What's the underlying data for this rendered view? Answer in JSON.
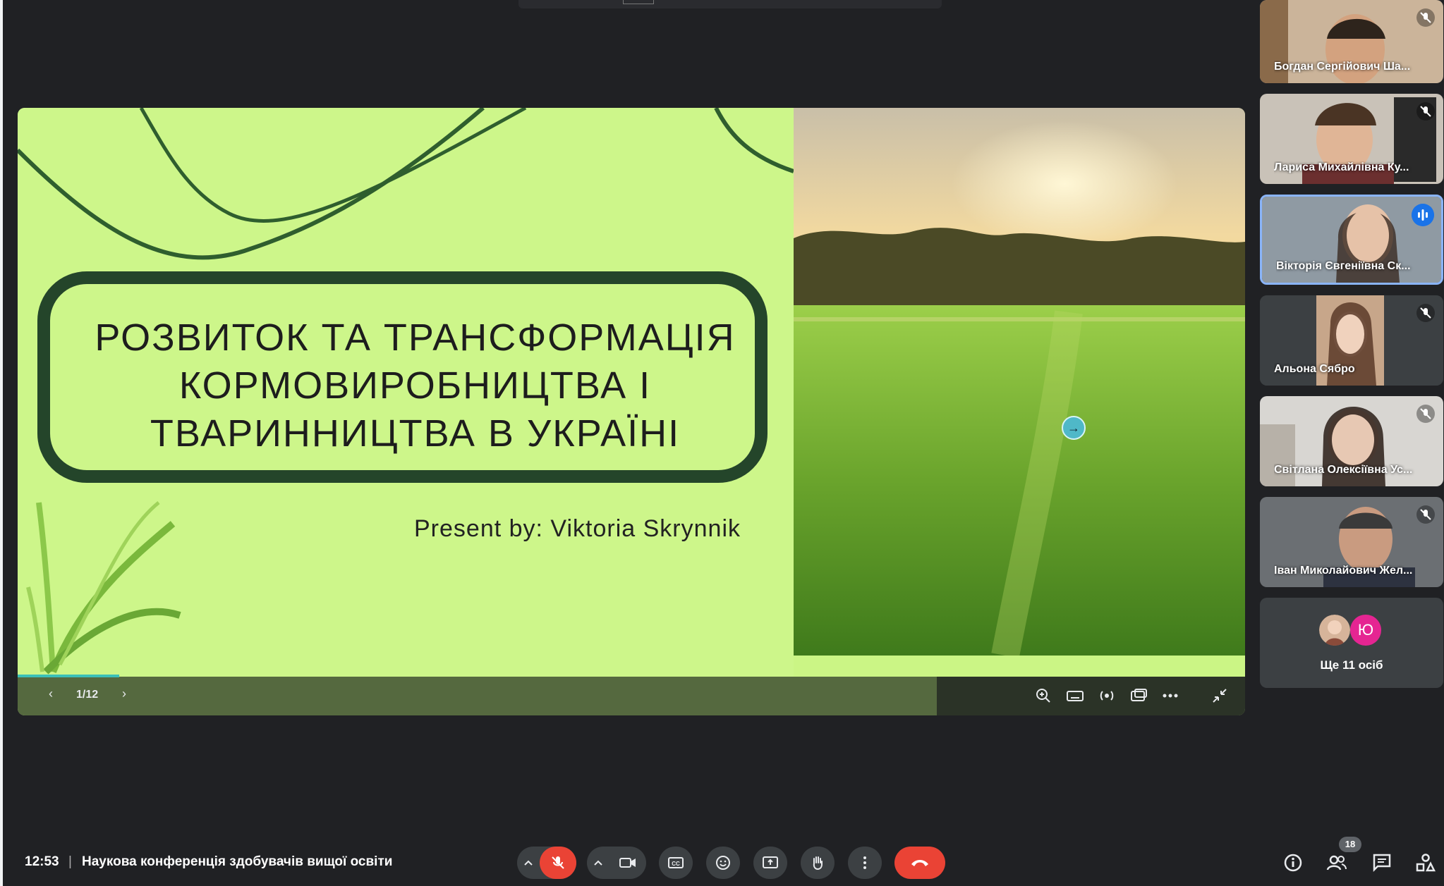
{
  "slide": {
    "title_lines": [
      "РОЗВИТОК ТА ТРАНСФОРМАЦІЯ",
      "КОРМОВИРОБНИЦТВА І",
      "ТВАРИННИЦТВА В УКРАЇНІ"
    ],
    "presenter": "Present by: Viktoria Skrynnik",
    "page_indicator": "1/12",
    "progress_fraction": 0.083
  },
  "participants": [
    {
      "name": "Богдан Сергійович Ша...",
      "muted": true,
      "speaking": false
    },
    {
      "name": "Лариса Михайлівна Ку...",
      "muted": true,
      "speaking": false
    },
    {
      "name": "Вікторія Євгеніївна Ск...",
      "muted": false,
      "speaking": true
    },
    {
      "name": "Альона Сябро",
      "muted": true,
      "speaking": false
    },
    {
      "name": "Світлана Олексіївна Ус...",
      "muted": true,
      "speaking": false
    },
    {
      "name": "Іван Миколайович Жел...",
      "muted": true,
      "speaking": false
    }
  ],
  "more_participants": {
    "avatar_letter": "Ю",
    "label": "Ще 11 осіб"
  },
  "bottom_bar": {
    "time": "12:53",
    "separator": "|",
    "meeting_title": "Наукова конференція здобувачів вищої освіти",
    "participant_count": "18"
  },
  "icons": {
    "controls": [
      "mic-off-icon",
      "camera-icon",
      "captions-icon",
      "emoji-icon",
      "present-icon",
      "raise-hand-icon",
      "more-options-icon",
      "end-call-icon"
    ],
    "right": [
      "info-icon",
      "people-icon",
      "chat-icon",
      "activities-icon"
    ],
    "slide_toolbar": [
      "zoom-icon",
      "keyboard-icon",
      "broadcast-icon",
      "pip-icon",
      "more-icon",
      "collapse-icon"
    ]
  },
  "colors": {
    "background": "#202124",
    "slide_green": "#cdf68a",
    "title_border": "#24452a",
    "end_call": "#ea4335",
    "speaking_accent": "#1a73e8",
    "tile_bg": "#3c4043"
  }
}
